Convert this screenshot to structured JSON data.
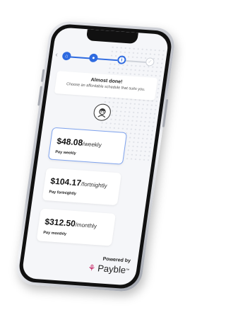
{
  "colors": {
    "accent": "#2e6ae0",
    "brand": "#c2185b"
  },
  "stepper": {
    "back_icon": "chevron-left-icon",
    "steps": [
      {
        "state": "done",
        "icon": "home-icon",
        "glyph": "⌂"
      },
      {
        "state": "done",
        "icon": "step-icon",
        "glyph": "●"
      },
      {
        "state": "active",
        "icon": "info-icon",
        "glyph": "i"
      },
      {
        "state": "todo",
        "icon": "check-icon",
        "glyph": "✓"
      }
    ]
  },
  "header": {
    "title": "Almost done!",
    "subtitle": "Choose an affordable schedule that suits you."
  },
  "avatar_icon": "person-avatar-icon",
  "options": [
    {
      "amount": "$48.08",
      "frequency": "/weekly",
      "label": "Pay weekly",
      "selected": true
    },
    {
      "amount": "$104.17",
      "frequency": "/fortnightly",
      "label": "Pay fortnightly",
      "selected": false
    },
    {
      "amount": "$312.50",
      "frequency": "/monthly",
      "label": "Pay monthly",
      "selected": false
    }
  ],
  "footer": {
    "powered_by": "Powered by",
    "brand_name": "Payble",
    "brand_mark": "™",
    "brand_icon": "payble-logo-icon"
  }
}
